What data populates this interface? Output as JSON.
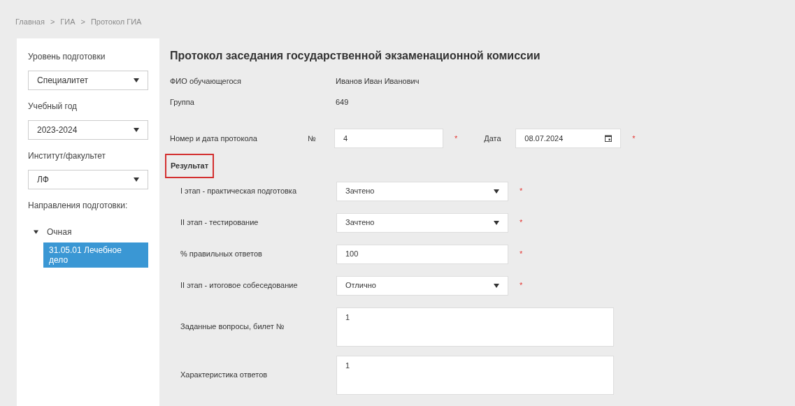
{
  "breadcrumbs": [
    "Главная",
    "ГИА",
    "Протокол ГИА"
  ],
  "breadcrumb_separator": ">",
  "sidebar": {
    "filters": [
      {
        "label": "Уровень подготовки",
        "value": "Специалитет"
      },
      {
        "label": "Учебный год",
        "value": "2023-2024"
      },
      {
        "label": "Институт/факультет",
        "value": "ЛФ"
      }
    ],
    "tree_label": "Направления подготовки:",
    "tree": [
      {
        "label": "Очная",
        "expanded": true,
        "selected": false,
        "children": [
          {
            "label": "31.05.01 Лечебное дело",
            "selected": true
          }
        ]
      }
    ]
  },
  "title": "Протокол заседания государственной экзаменационной комиссии",
  "info": [
    {
      "label": "ФИО обучающегося",
      "value": "Иванов Иван Иванович"
    },
    {
      "label": "Группа",
      "value": "649"
    }
  ],
  "protocol": {
    "label": "Номер и дата протокола",
    "number_label": "№",
    "number": "4",
    "required_mark": "*",
    "date_label": "Дата",
    "date": "08.07.2024"
  },
  "result": {
    "heading": "Результат",
    "highlighted": true,
    "fields": [
      {
        "kind": "select",
        "label": "I этап - практическая подготовка",
        "value": "Зачтено",
        "required": true
      },
      {
        "kind": "select",
        "label": "II этап - тестирование",
        "value": "Зачтено",
        "required": true
      },
      {
        "kind": "input",
        "label": "% правильных ответов",
        "value": "100",
        "required": true
      },
      {
        "kind": "select",
        "label": "II этап - итоговое собеседование",
        "value": "Отлично",
        "required": true
      },
      {
        "kind": "textarea",
        "label": "Заданные вопросы, билет №",
        "value": "1",
        "required": false
      },
      {
        "kind": "textarea",
        "label": "Характеристика ответов",
        "value": "1",
        "required": false
      }
    ]
  }
}
